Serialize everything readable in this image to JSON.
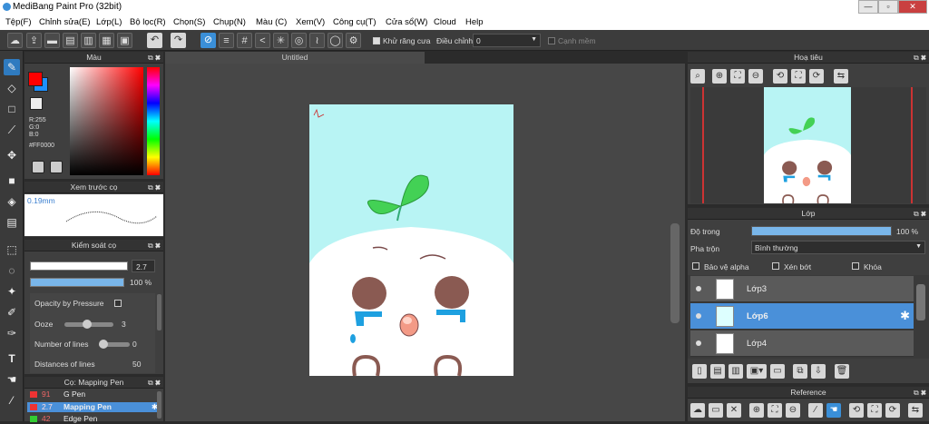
{
  "window": {
    "title": "MediBang Paint Pro (32bit)",
    "minimize": "—",
    "maximize": "▫",
    "close": "✕"
  },
  "menu": [
    "Tệp(F)",
    "Chỉnh sửa(E)",
    "Lớp(L)",
    "Bộ lọc(R)",
    "Chọn(S)",
    "Chụp(N)",
    "Màu (C)",
    "Xem(V)",
    "Công cụ(T)",
    "Cửa sổ(W)",
    "Cloud",
    "Help"
  ],
  "toolbar": {
    "antialias_label": "Khử răng cưa",
    "adjust_label": "Điều chỉnh",
    "adjust_value": "0",
    "edge_label": "Cạnh mềm"
  },
  "document": {
    "tab_title": "Untitled"
  },
  "color_panel": {
    "title": "Màu",
    "r": "R:255",
    "g": "G:0",
    "b": "B:0",
    "hex": "#FF0000",
    "fg_color": "#ff0000",
    "bg_color": "#1e90ff"
  },
  "brush_preview": {
    "title": "Xem trước cọ",
    "size": "0.19mm"
  },
  "brush_control": {
    "title": "Kiểm soát cọ",
    "size_value": "2.7",
    "opacity_value": "100 %",
    "opacity_pressure": "Opacity by Pressure",
    "ooze_label": "Ooze",
    "ooze_value": "3",
    "lines_label": "Number of lines",
    "lines_value": "0",
    "distance_label": "Distances of lines",
    "distance_value": "50"
  },
  "brushes": {
    "title": "Cọ: Mapping Pen",
    "items": [
      {
        "size": "91",
        "name": "G Pen",
        "color": "#e33333"
      },
      {
        "size": "2.7",
        "name": "Mapping Pen",
        "color": "#e33333"
      },
      {
        "size": "42",
        "name": "Edge Pen",
        "color": "#33cc33"
      }
    ]
  },
  "navigator": {
    "title": "Hoạ tiêu"
  },
  "layer_panel": {
    "title": "Lớp",
    "opacity_label": "Độ trong",
    "opacity_value": "100 %",
    "blend_label": "Pha trộn",
    "blend_value": "Bình thường",
    "protect_alpha": "Bảo vệ alpha",
    "clipping": "Xén bớt",
    "lock": "Khóa",
    "layers": [
      {
        "name": "Lớp3",
        "selected": false
      },
      {
        "name": "Lớp6",
        "selected": true
      },
      {
        "name": "Lớp4",
        "selected": false
      }
    ]
  },
  "reference": {
    "title": "Reference"
  }
}
